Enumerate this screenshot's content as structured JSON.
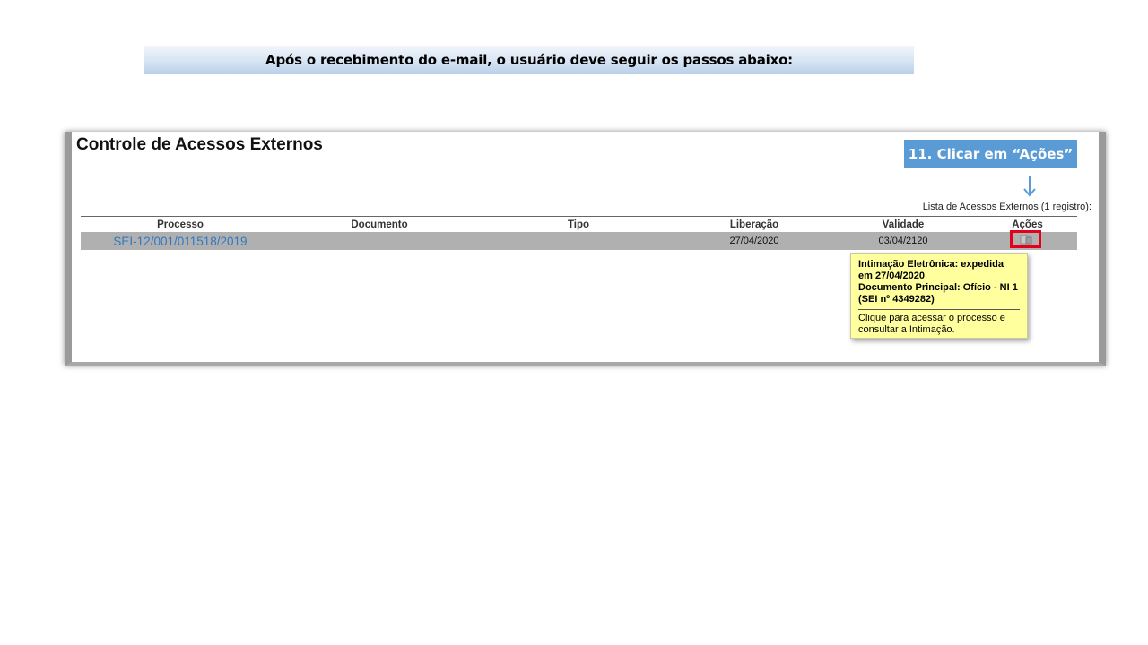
{
  "banner": {
    "text": "Após o recebimento do e-mail, o usuário deve seguir os passos abaixo:"
  },
  "page": {
    "title": "Controle de Acessos Externos"
  },
  "callout": {
    "text": "11. Clicar em “Ações”",
    "color": "#5b9bd5"
  },
  "list": {
    "caption": "Lista de Acessos Externos (1 registro):",
    "columns": [
      "Processo",
      "Documento",
      "Tipo",
      "Liberação",
      "Validade",
      "Ações"
    ],
    "rows": [
      {
        "processo": "SEI-12/001/011518/2019",
        "documento": "",
        "tipo": "",
        "liberacao": "27/04/2020",
        "validade": "03/04/2120",
        "acoes_icon": "open-process-icon"
      }
    ]
  },
  "tooltip": {
    "line1": "Intimação Eletrônica: expedida em 27/04/2020",
    "line2": "Documento Principal: Ofício - NI 1 (SEI nº 4349282)",
    "line3": "Clique para acessar o processo e consultar a Intimação."
  },
  "colors": {
    "highlight": "#e3001b",
    "link": "#2f78c4",
    "tooltip_bg": "#ffff9e",
    "row_bg": "#b0b0b0"
  }
}
